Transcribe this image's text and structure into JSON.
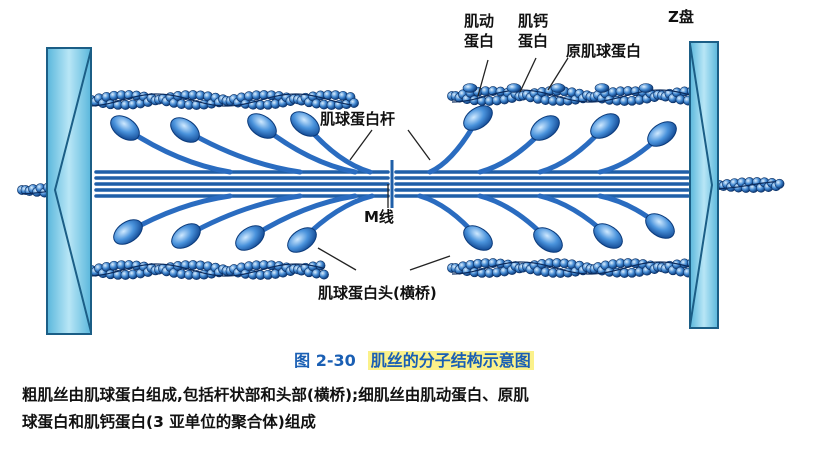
{
  "labels": {
    "z_disc": "Z盘",
    "actin_line1": "肌动",
    "actin_line2": "蛋白",
    "troponin_line1": "肌钙",
    "troponin_line2": "蛋白",
    "tropomyosin": "原肌球蛋白",
    "myosin_rod": "肌球蛋白杆",
    "m_line": "M线",
    "myosin_head": "肌球蛋白头(横桥)"
  },
  "caption": {
    "number": "图 2-30",
    "title": "肌丝的分子结构示意图"
  },
  "description": [
    "粗肌丝由肌球蛋白组成,包括杆状部和头部(横桥);细肌丝由肌动蛋白、原肌",
    "球蛋白和肌钙蛋白(3 亚单位的聚合体)组成"
  ],
  "colors": {
    "z_disc_fill": "#8fd0e8",
    "thin_filament": "#1f5fa8",
    "thick_filament": "#2a6cc0",
    "head_fill": "#3a86d4",
    "caption_text": "#1a5fb4",
    "caption_highlight": "#fbf18a"
  }
}
